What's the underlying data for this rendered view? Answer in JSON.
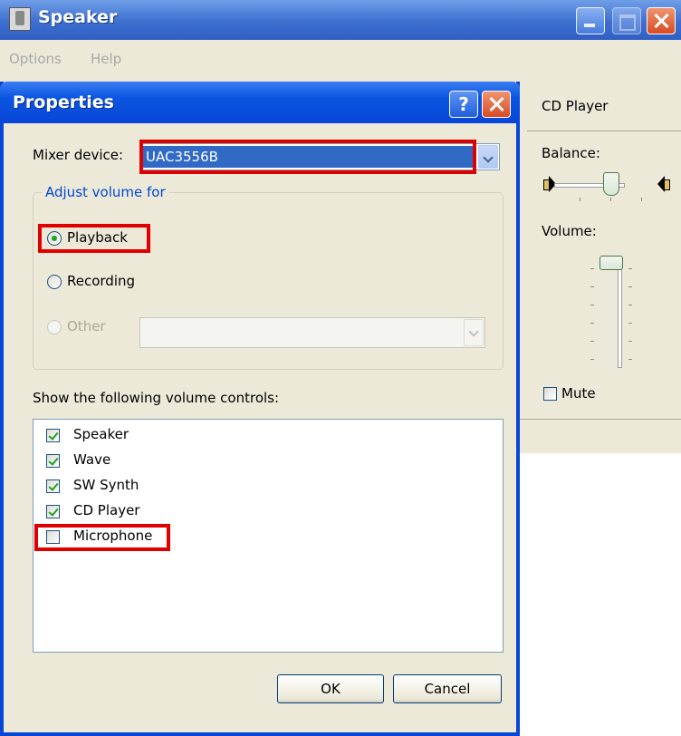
{
  "colors": {
    "highlight": "#e00000",
    "titlebar": "#0846d8",
    "group_title": "#0046d5"
  },
  "back_window": {
    "title": "Speaker",
    "menu": [
      "Options",
      "Help"
    ],
    "panel": {
      "column_label": "CD Player",
      "balance_label": "Balance:",
      "volume_label": "Volume:",
      "mute_label": "Mute",
      "mute_checked": false
    }
  },
  "dialog": {
    "title": "Properties",
    "help_glyph": "?",
    "mixer_label": "Mixer device:",
    "mixer_value": "UAC3556B",
    "group_title": "Adjust volume for",
    "radios": [
      {
        "label": "Playback",
        "checked": true,
        "disabled": false
      },
      {
        "label": "Recording",
        "checked": false,
        "disabled": false
      },
      {
        "label": "Other",
        "checked": false,
        "disabled": true
      }
    ],
    "other_combo_value": "",
    "controls_label": "Show the following volume controls:",
    "controls": [
      {
        "label": "Speaker",
        "checked": true
      },
      {
        "label": "Wave",
        "checked": true
      },
      {
        "label": "SW Synth",
        "checked": true
      },
      {
        "label": "CD Player",
        "checked": true
      },
      {
        "label": "Microphone",
        "checked": false
      }
    ],
    "ok_label": "OK",
    "cancel_label": "Cancel"
  }
}
